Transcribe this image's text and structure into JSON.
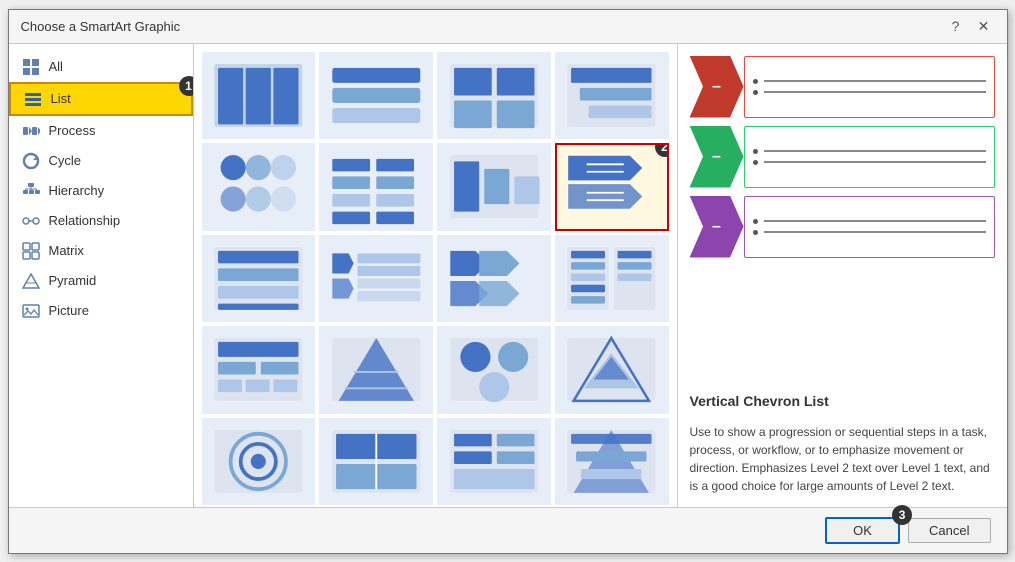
{
  "dialog": {
    "title": "Choose a SmartArt Graphic",
    "help_label": "?",
    "close_label": "✕"
  },
  "sidebar": {
    "items": [
      {
        "id": "all",
        "label": "All",
        "icon": "grid"
      },
      {
        "id": "list",
        "label": "List",
        "icon": "list",
        "active": true
      },
      {
        "id": "process",
        "label": "Process",
        "icon": "process"
      },
      {
        "id": "cycle",
        "label": "Cycle",
        "icon": "cycle"
      },
      {
        "id": "hierarchy",
        "label": "Hierarchy",
        "icon": "hierarchy"
      },
      {
        "id": "relationship",
        "label": "Relationship",
        "icon": "relationship"
      },
      {
        "id": "matrix",
        "label": "Matrix",
        "icon": "matrix"
      },
      {
        "id": "pyramid",
        "label": "Pyramid",
        "icon": "pyramid"
      },
      {
        "id": "picture",
        "label": "Picture",
        "icon": "picture"
      }
    ]
  },
  "right_panel": {
    "title": "Vertical Chevron List",
    "description": "Use to show a progression or sequential steps in a task, process, or workflow, or to emphasize movement or direction. Emphasizes Level 2 text over Level 1 text, and is a good choice for large amounts of Level 2 text.",
    "items": [
      {
        "color": "#c0392b",
        "border_color": "#e74c3c"
      },
      {
        "color": "#27ae60",
        "border_color": "#2ecc71"
      },
      {
        "color": "#8e44ad",
        "border_color": "#9b59b6"
      }
    ]
  },
  "buttons": {
    "ok": "OK",
    "cancel": "Cancel"
  },
  "badges": {
    "list_badge": "1",
    "selected_badge": "2",
    "ok_badge": "3"
  }
}
